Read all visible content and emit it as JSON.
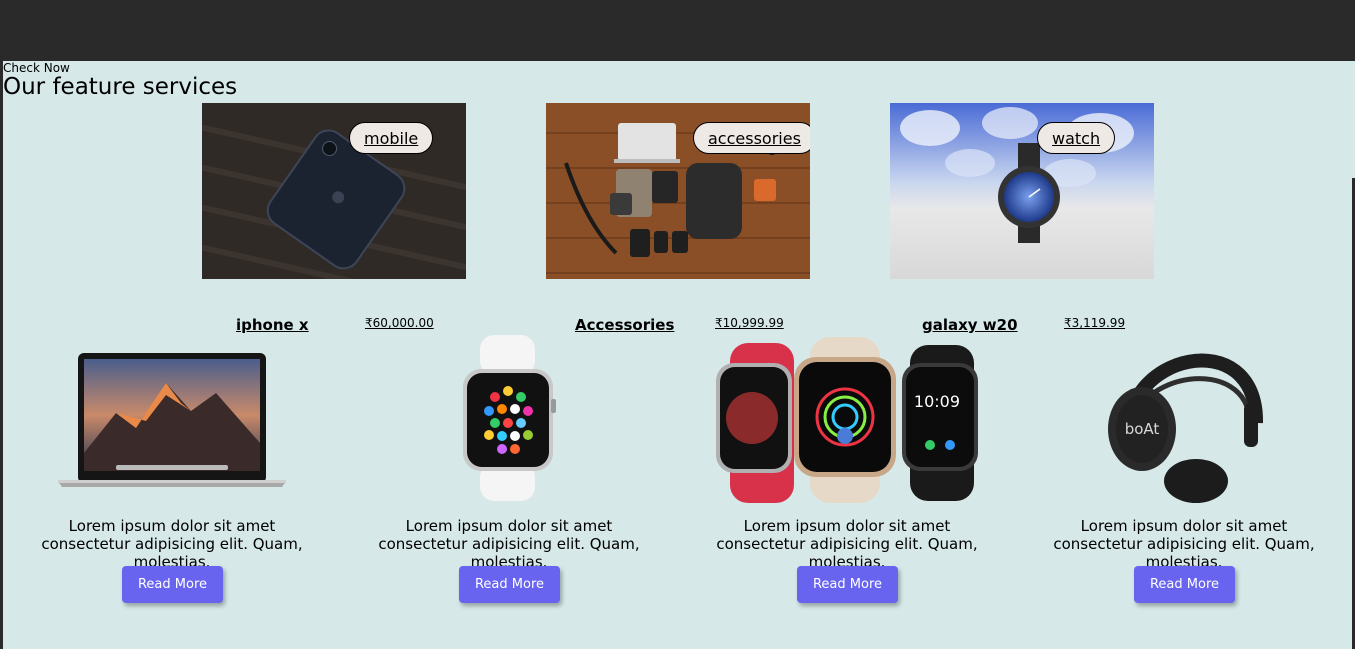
{
  "header": {
    "check_now": "Check Now",
    "title": "Our feature services"
  },
  "features": [
    {
      "label": "mobile",
      "icon": "phone-photo"
    },
    {
      "label": "accessories",
      "icon": "accessories-photo"
    },
    {
      "label": "watch",
      "icon": "smartwatch-photo"
    }
  ],
  "products_header": [
    {
      "name": "iphone x",
      "price": "₹60,000.00"
    },
    {
      "name": "Accessories",
      "price": "₹10,999.99"
    },
    {
      "name": "galaxy w20",
      "price": "₹3,119.99"
    }
  ],
  "cards": [
    {
      "image": "laptop-photo",
      "description": "Lorem ipsum dolor sit amet consectetur adipisicing elit. Quam, molestias.",
      "button": "Read More"
    },
    {
      "image": "watch-photo",
      "description": "Lorem ipsum dolor sit amet consectetur adipisicing elit. Quam, molestias.",
      "button": "Read More"
    },
    {
      "image": "watches-photo",
      "description": "Lorem ipsum dolor sit amet consectetur adipisicing elit. Quam, molestias.",
      "button": "Read More"
    },
    {
      "image": "headphones-photo",
      "description": "Lorem ipsum dolor sit amet consectetur adipisicing elit. Quam, molestias.",
      "button": "Read More"
    }
  ],
  "colors": {
    "background": "#d6e8e8",
    "topbar": "#2a2a2a",
    "button": "#6864f0"
  }
}
